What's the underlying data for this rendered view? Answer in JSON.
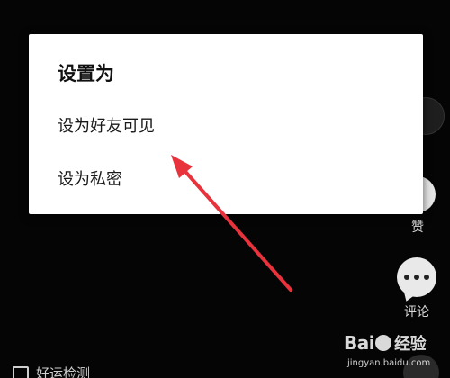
{
  "dialog": {
    "title": "设置为",
    "options": [
      {
        "label": "设为好友可见"
      },
      {
        "label": "设为私密"
      }
    ]
  },
  "rail": {
    "like_label": "赞",
    "comment_label": "评论"
  },
  "bottom_tag": {
    "label": "好运检测"
  },
  "annotation": {
    "arrow_color": "#e8323c"
  },
  "watermark": {
    "brand": "Bai",
    "brand_suffix": "经验",
    "url": "jingyan.baidu.com"
  },
  "colors": {
    "background": "#050505",
    "dialog_background": "#ffffff",
    "text_primary": "#111111"
  }
}
